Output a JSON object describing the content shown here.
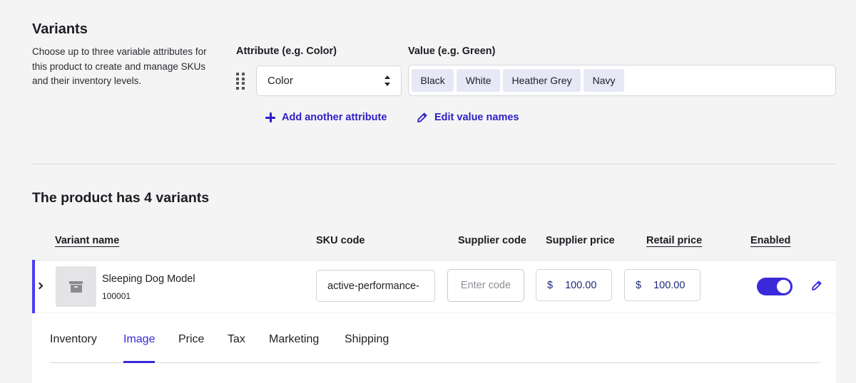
{
  "variants_section": {
    "title": "Variants",
    "description": "Choose up to three variable attributes for this product to create and manage SKUs and their inventory levels.",
    "attribute_label": "Attribute (e.g. Color)",
    "value_label": "Value (e.g. Green)",
    "attribute_selected": "Color",
    "values": [
      "Black",
      "White",
      "Heather Grey",
      "Navy"
    ],
    "add_attribute": "Add another attribute",
    "edit_value_names": "Edit value names"
  },
  "variant_table": {
    "title": "The product has 4 variants",
    "columns": {
      "variant_name": "Variant name",
      "sku_code": "SKU code",
      "supplier_code": "Supplier code",
      "supplier_price": "Supplier price",
      "retail_price": "Retail price",
      "enabled": "Enabled"
    },
    "rows": [
      {
        "name": "Sleeping Dog Model",
        "code": "100001",
        "sku": "active-performance-",
        "supplier_code_placeholder": "Enter code",
        "supplier_price_currency": "$",
        "supplier_price": "100.00",
        "retail_price_currency": "$",
        "retail_price": "100.00",
        "enabled": true
      }
    ]
  },
  "detail_tabs": {
    "items": [
      "Inventory",
      "Image",
      "Price",
      "Tax",
      "Marketing",
      "Shipping"
    ],
    "active": "Image"
  },
  "colors": {
    "accent": "#3a2ad9",
    "link": "#2d1fc4",
    "tag_bg": "#e6e8f6",
    "page_bg": "#f4f4f5"
  },
  "icons": {
    "drag": "drag-handle-icon",
    "add": "plus-icon",
    "edit": "pencil-icon",
    "expand": "chevron-right-icon",
    "thumbnail": "box-icon"
  }
}
